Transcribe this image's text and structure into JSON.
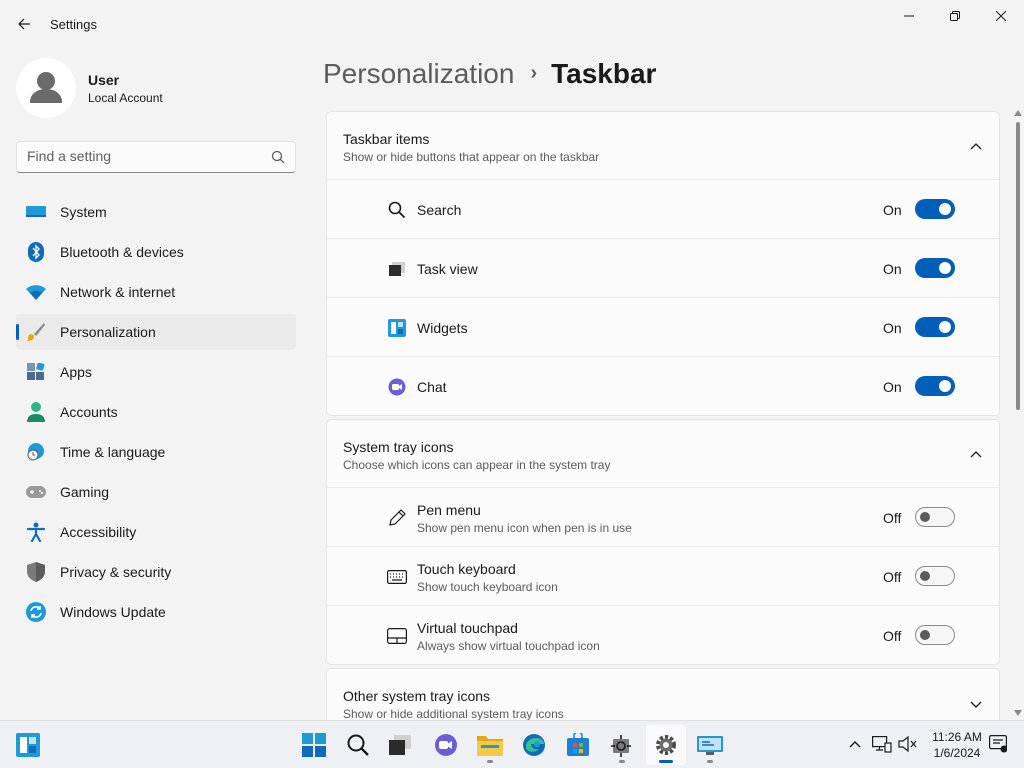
{
  "window": {
    "title": "Settings",
    "controls": {
      "minimize": "minimize",
      "maximize": "maximize",
      "close": "close"
    }
  },
  "profile": {
    "name": "User",
    "account_type": "Local Account"
  },
  "search": {
    "placeholder": "Find a setting"
  },
  "sidebar": {
    "items": [
      {
        "label": "System",
        "icon": "system-icon"
      },
      {
        "label": "Bluetooth & devices",
        "icon": "bluetooth-icon"
      },
      {
        "label": "Network & internet",
        "icon": "wifi-icon"
      },
      {
        "label": "Personalization",
        "icon": "brush-icon",
        "active": true
      },
      {
        "label": "Apps",
        "icon": "apps-icon"
      },
      {
        "label": "Accounts",
        "icon": "accounts-icon"
      },
      {
        "label": "Time & language",
        "icon": "globe-clock-icon"
      },
      {
        "label": "Gaming",
        "icon": "gamepad-icon"
      },
      {
        "label": "Accessibility",
        "icon": "accessibility-icon"
      },
      {
        "label": "Privacy & security",
        "icon": "shield-icon"
      },
      {
        "label": "Windows Update",
        "icon": "update-icon"
      }
    ]
  },
  "breadcrumb": {
    "parent": "Personalization",
    "separator": "›",
    "current": "Taskbar"
  },
  "sections": {
    "taskbar_items": {
      "title": "Taskbar items",
      "subtitle": "Show or hide buttons that appear on the taskbar",
      "expanded": true,
      "rows": [
        {
          "label": "Search",
          "state": "On",
          "icon": "search-icon"
        },
        {
          "label": "Task view",
          "state": "On",
          "icon": "task-view-icon"
        },
        {
          "label": "Widgets",
          "state": "On",
          "icon": "widgets-icon"
        },
        {
          "label": "Chat",
          "state": "On",
          "icon": "chat-icon"
        }
      ]
    },
    "system_tray": {
      "title": "System tray icons",
      "subtitle": "Choose which icons can appear in the system tray",
      "expanded": true,
      "rows": [
        {
          "label": "Pen menu",
          "description": "Show pen menu icon when pen is in use",
          "state": "Off",
          "icon": "pen-icon"
        },
        {
          "label": "Touch keyboard",
          "description": "Show touch keyboard icon",
          "state": "Off",
          "icon": "keyboard-icon"
        },
        {
          "label": "Virtual touchpad",
          "description": "Always show virtual touchpad icon",
          "state": "Off",
          "icon": "touchpad-icon"
        }
      ]
    },
    "other_tray": {
      "title": "Other system tray icons",
      "subtitle": "Show or hide additional system tray icons",
      "expanded": false
    }
  },
  "taskbar": {
    "apps": [
      "windows-logo-icon",
      "start-icon",
      "search-icon",
      "task-view-icon",
      "chat-icon",
      "file-explorer-icon",
      "edge-icon",
      "store-icon",
      "device-manager-icon",
      "settings-icon",
      "remote-desktop-icon"
    ],
    "active_app": "settings-icon",
    "clock": {
      "time": "11:26 AM",
      "date": "1/6/2024"
    }
  },
  "colors": {
    "accent": "#005fb8",
    "background": "#f3f3f3",
    "card": "#fbfbfb"
  }
}
